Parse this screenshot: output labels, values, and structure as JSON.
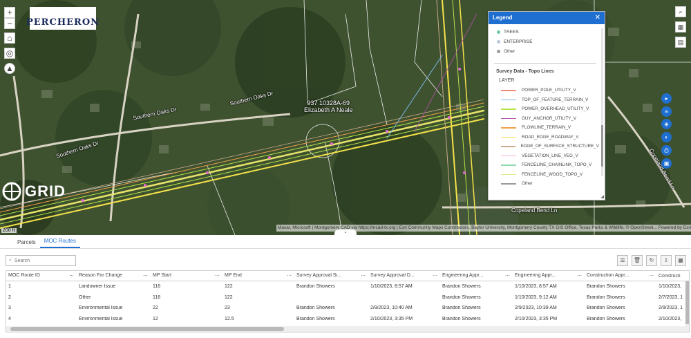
{
  "map": {
    "logo_text": "PERCHERON",
    "grid_logo_text": "GRID",
    "zoom_in": "+",
    "zoom_out": "−",
    "parcel_label_line1": "937 10328A-69",
    "parcel_label_line2": "Elizabeth A Neale",
    "road_labels": [
      "Southern Oaks Dr",
      "Southern Oaks Dr",
      "Southern Oaks Dr",
      "Copeland Bend Ln",
      "Copeland Bend Ln"
    ],
    "attribution": "Maxar, Microsoft | Montgomery CAD via https://mcad-tx.org | Esri Community Maps Contributors, Baylor University, Montgomery County TX GIS Office, Texas Parks & Wildlife, © OpenStreet...   Powered by Esri",
    "scale": "200 ft"
  },
  "legend": {
    "title": "Legend",
    "point_items": [
      {
        "label": "TREES",
        "color": "#6fc7a6"
      },
      {
        "label": "ENTERPRISE",
        "color": "#b9c6d9"
      },
      {
        "label": "Other",
        "color": "#999999"
      }
    ],
    "section_title": "Survey Data - Topo Lines",
    "layer_label": "LAYER",
    "line_items": [
      {
        "label": "POWER_POLE_UTILITY_V",
        "color": "#f08a7a"
      },
      {
        "label": "TOP_OF_FEATURE_TERRAIN_V",
        "color": "#7ab8e0"
      },
      {
        "label": "POWER_OVERHEAD_UTILITY_V",
        "color": "#b6e34a"
      },
      {
        "label": "GUY_ANCHOR_UTILITY_V",
        "color": "#b64fb0"
      },
      {
        "label": "FLOWLINE_TERRAIN_V",
        "color": "#f0a04b"
      },
      {
        "label": "ROAD_EDGE_ROADWAY_V",
        "color": "#f5e24a"
      },
      {
        "label": "EDGE_OF_SURFACE_STRUCTURE_V",
        "color": "#c8a98a"
      },
      {
        "label": "VEGETATION_LINE_VEG_V",
        "color": "#f0b8d8"
      },
      {
        "label": "FENCELINE_CHAINLINK_TOPO_V",
        "color": "#8fd8b0"
      },
      {
        "label": "FENCELINE_WOOD_TOPO_V",
        "color": "#d8ec8a"
      },
      {
        "label": "Other",
        "color": "#999999"
      }
    ]
  },
  "panel": {
    "tabs": [
      "Parcels",
      "MOC Routes"
    ],
    "active_tab": "MOC Routes",
    "search_placeholder": "Search",
    "columns": [
      "MOC Route ID",
      "Reason For Change",
      "MP Start",
      "MP End",
      "Survey Approval Si...",
      "Survey Approval D...",
      "Engineering Appr...",
      "Engineering Appr...",
      "Construction Appr...",
      "Constructi"
    ],
    "rows": [
      [
        "1",
        "Landowner Issue",
        "116",
        "122",
        "Brandon Showers",
        "1/10/2023, 8:57 AM",
        "Brandon Showers",
        "1/10/2023, 8:57 AM",
        "Brandon Showers",
        "1/10/2023,"
      ],
      [
        "2",
        "Other",
        "116",
        "122",
        "",
        "",
        "Brandon Showers",
        "1/10/2023, 9:12 AM",
        "Brandon Showers",
        "2/7/2023, 1"
      ],
      [
        "3",
        "Environmental Issue",
        "22",
        "23",
        "Brandon Showers",
        "2/9/2023, 10:40 AM",
        "Brandon Showers",
        "2/9/2023, 10:39 AM",
        "Brandon Showers",
        "2/9/2023, 1"
      ],
      [
        "4",
        "Environmental Issue",
        "12",
        "12.5",
        "Brandon Showers",
        "2/10/2023, 3:35 PM",
        "Brandon Showers",
        "2/10/2023, 3:35 PM",
        "Brandon Showers",
        "2/10/2023,"
      ]
    ]
  }
}
